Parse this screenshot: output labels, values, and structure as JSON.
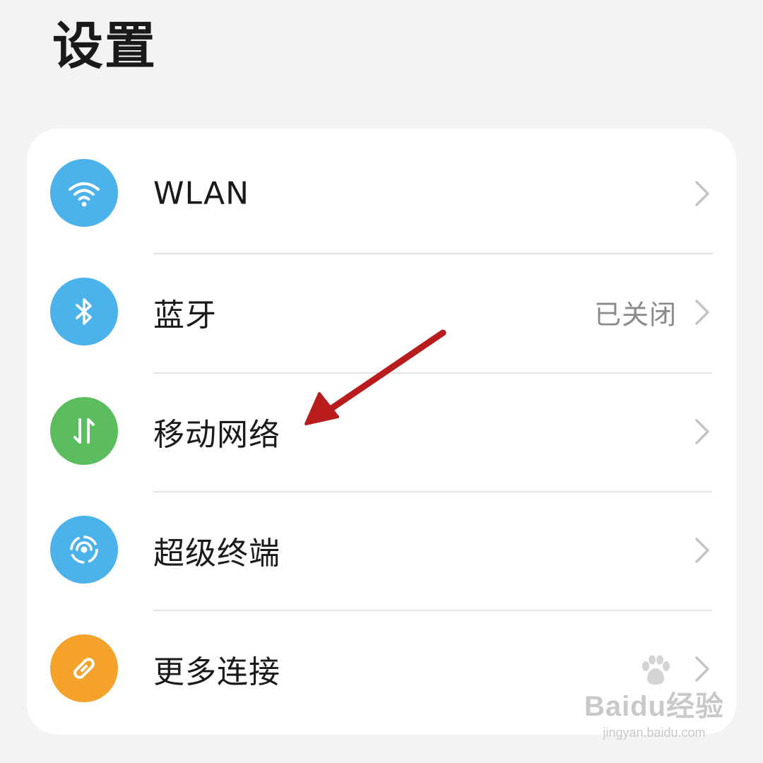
{
  "header": {
    "title": "设置"
  },
  "settings": {
    "items": [
      {
        "label": "WLAN",
        "status": "",
        "icon": "wifi-icon",
        "color": "#4cb2ea"
      },
      {
        "label": "蓝牙",
        "status": "已关闭",
        "icon": "bluetooth-icon",
        "color": "#4cb2ea"
      },
      {
        "label": "移动网络",
        "status": "",
        "icon": "mobile-data-icon",
        "color": "#5cbd5e"
      },
      {
        "label": "超级终端",
        "status": "",
        "icon": "super-device-icon",
        "color": "#4cb2ea"
      },
      {
        "label": "更多连接",
        "status": "",
        "icon": "link-icon",
        "color": "#f5a22d"
      }
    ]
  },
  "annotation": {
    "arrow_color": "#b81c1c"
  },
  "watermark": {
    "brand": "Baidu经验",
    "site": "jingyan.baidu.com"
  }
}
